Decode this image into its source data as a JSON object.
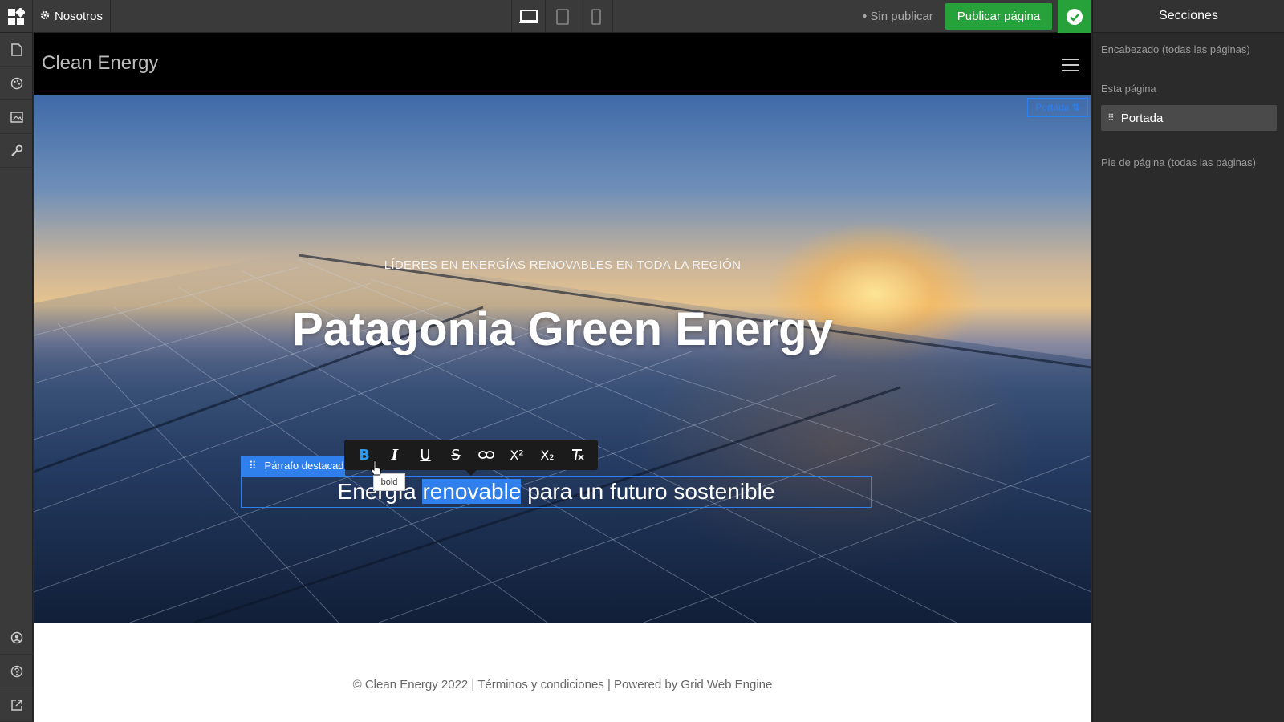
{
  "topbar": {
    "page_name": "Nosotros",
    "status": "• Sin publicar",
    "publish_label": "Publicar página",
    "devices": [
      "desktop-icon",
      "tablet-icon",
      "mobile-icon"
    ]
  },
  "rail": {
    "top_icons": [
      "page-icon",
      "palette-icon",
      "image-icon",
      "tools-icon"
    ],
    "bottom_icons": [
      "account-icon",
      "help-icon",
      "external-link-icon"
    ]
  },
  "site": {
    "title": "Clean Energy",
    "hero": {
      "section_tag": "Portada ⇅",
      "kicker": "LÍDERES EN ENERGÍAS RENOVABLES EN TODA LA REGIÓN",
      "title": "Patagonia Green Energy",
      "block_label": "Párrafo destacado",
      "subtitle_before": "Energía ",
      "subtitle_selected": "renovable",
      "subtitle_after": " para un futuro sostenible"
    },
    "footer": "© Clean Energy 2022 | Términos y condiciones | Powered by Grid Web Engine"
  },
  "toolbar": {
    "buttons": [
      "B",
      "I",
      "U",
      "S",
      "link",
      "X²",
      "X₂",
      "clear"
    ],
    "tooltip": "bold"
  },
  "panel": {
    "title": "Secciones",
    "header_section": "Encabezado (todas las páginas)",
    "this_page": "Esta página",
    "item": "Portada",
    "footer_section": "Pie de página (todas las páginas)"
  },
  "colors": {
    "accent": "#2f80ed",
    "publish": "#27a23b",
    "chrome": "#3a3a3a"
  }
}
